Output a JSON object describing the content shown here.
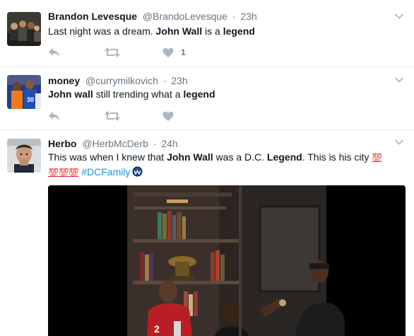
{
  "tweets": [
    {
      "name": "Brandon Levesque",
      "handle": "@BrandoLevesque",
      "dot": "·",
      "time": "23h",
      "text_parts": [
        "Last night was a dream. ",
        "John Wall",
        " is a ",
        "legend"
      ],
      "like_count": "1",
      "icons": [
        "reply-icon",
        "retweet-icon",
        "like-icon",
        "chevron-down-icon"
      ]
    },
    {
      "name": "money",
      "handle": "@currymilkovich",
      "dot": "·",
      "time": "23h",
      "text_parts": [
        "John wall",
        " still trending what a ",
        "legend"
      ],
      "icons": [
        "reply-icon",
        "retweet-icon",
        "like-icon",
        "chevron-down-icon"
      ]
    },
    {
      "name": "Herbo",
      "handle": "@HerbMcDerb",
      "dot": "·",
      "time": "24h",
      "text_parts": [
        "This was when I knew that ",
        "John Wall",
        " was a D.C. ",
        "Legend",
        ". This is his city "
      ],
      "emoji_100": "💯",
      "emoji_100_triple": "💯💯💯",
      "hashtag": "#DCFamily",
      "icons": [
        "wizards-logo-icon",
        "chevron-down-icon",
        "video-player"
      ]
    }
  ],
  "colors": {
    "secondary_text": "#657786",
    "action_icon": "#aab8c2",
    "link": "#1b95e0",
    "divider": "#e6ecf0"
  }
}
